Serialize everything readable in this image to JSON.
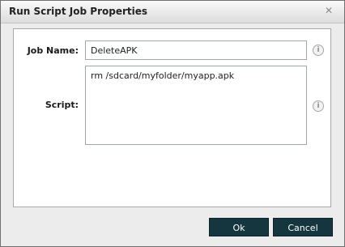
{
  "dialog": {
    "title": "Run Script Job Properties",
    "close_symbol": "✕"
  },
  "form": {
    "job_name_label": "Job Name:",
    "job_name_value": "DeleteAPK",
    "script_label": "Script:",
    "script_value": "rm /sdcard/myfolder/myapp.apk",
    "info_symbol": "i"
  },
  "buttons": {
    "ok_label": "Ok",
    "cancel_label": "Cancel"
  },
  "icons": {
    "close": "close-icon",
    "info": "info-icon"
  }
}
